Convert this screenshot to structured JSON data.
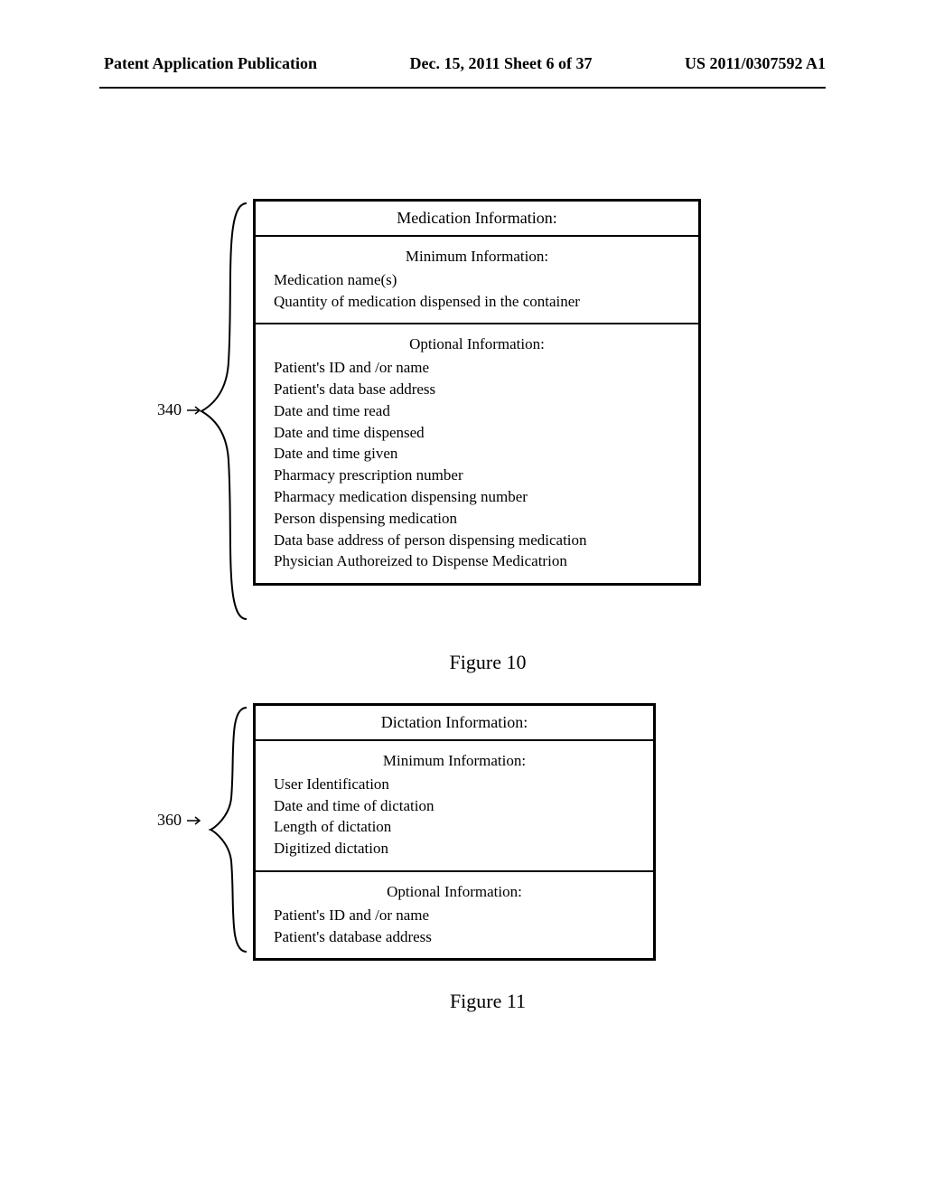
{
  "header": {
    "left": "Patent Application Publication",
    "center": "Dec. 15, 2011  Sheet 6 of 37",
    "right": "US 2011/0307592 A1"
  },
  "figure10": {
    "ref": "340",
    "title": "Medication Information:",
    "section1_heading": "Minimum Information:",
    "section1_line1": "Medication name(s)",
    "section1_line2": "Quantity of medication dispensed in the container",
    "section2_heading": "Optional Information:",
    "section2_line1": "Patient's ID and /or name",
    "section2_line2": "Patient's data base address",
    "section2_line3": "Date and time read",
    "section2_line4": "Date and time dispensed",
    "section2_line5": "Date and time given",
    "section2_line6": "Pharmacy prescription number",
    "section2_line7": "Pharmacy medication dispensing number",
    "section2_line8": "Person dispensing medication",
    "section2_line9": "Data base address of person dispensing medication",
    "section2_line10": "Physician Authoreized to Dispense Medicatrion",
    "caption": "Figure 10"
  },
  "figure11": {
    "ref": "360",
    "title": "Dictation Information:",
    "section1_heading": "Minimum Information:",
    "section1_line1": "User Identification",
    "section1_line2": "Date and time of dictation",
    "section1_line3": "Length of dictation",
    "section1_line4": "Digitized dictation",
    "section2_heading": "Optional Information:",
    "section2_line1": "Patient's ID and /or name",
    "section2_line2": "Patient's database address",
    "caption": "Figure 11"
  }
}
